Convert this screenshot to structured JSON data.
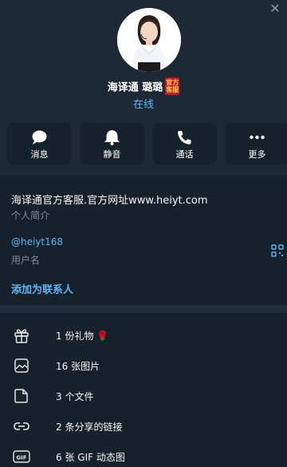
{
  "profile": {
    "name": "海译通 璐璐",
    "badge_line1": "官方",
    "badge_line2": "客服",
    "status": "在线"
  },
  "actions": [
    {
      "label": "消息",
      "icon": "chat-bubble-icon"
    },
    {
      "label": "静音",
      "icon": "bell-icon"
    },
    {
      "label": "通话",
      "icon": "phone-icon"
    },
    {
      "label": "更多",
      "icon": "more-dots-icon"
    }
  ],
  "info": {
    "bio": "海译通官方客服.官方网址www.heiyt.com",
    "bio_caption": "个人简介",
    "username": "@heiyt168",
    "username_caption": "用户名",
    "add_contact": "添加为联系人"
  },
  "media": [
    {
      "text": "1 份礼物 🌹",
      "icon": "gift-icon"
    },
    {
      "text": "16 张图片",
      "icon": "image-icon"
    },
    {
      "text": "3 个文件",
      "icon": "file-icon"
    },
    {
      "text": "2 条分享的链接",
      "icon": "link-icon"
    },
    {
      "text": "6 张 GIF 动态图",
      "icon": "gif-icon",
      "icon_label": "GIF"
    }
  ],
  "colors": {
    "background": "#17212b",
    "header": "#1e2936",
    "accent": "#5eb5f7",
    "muted": "#7f8b97",
    "badge": "#c9162a"
  }
}
